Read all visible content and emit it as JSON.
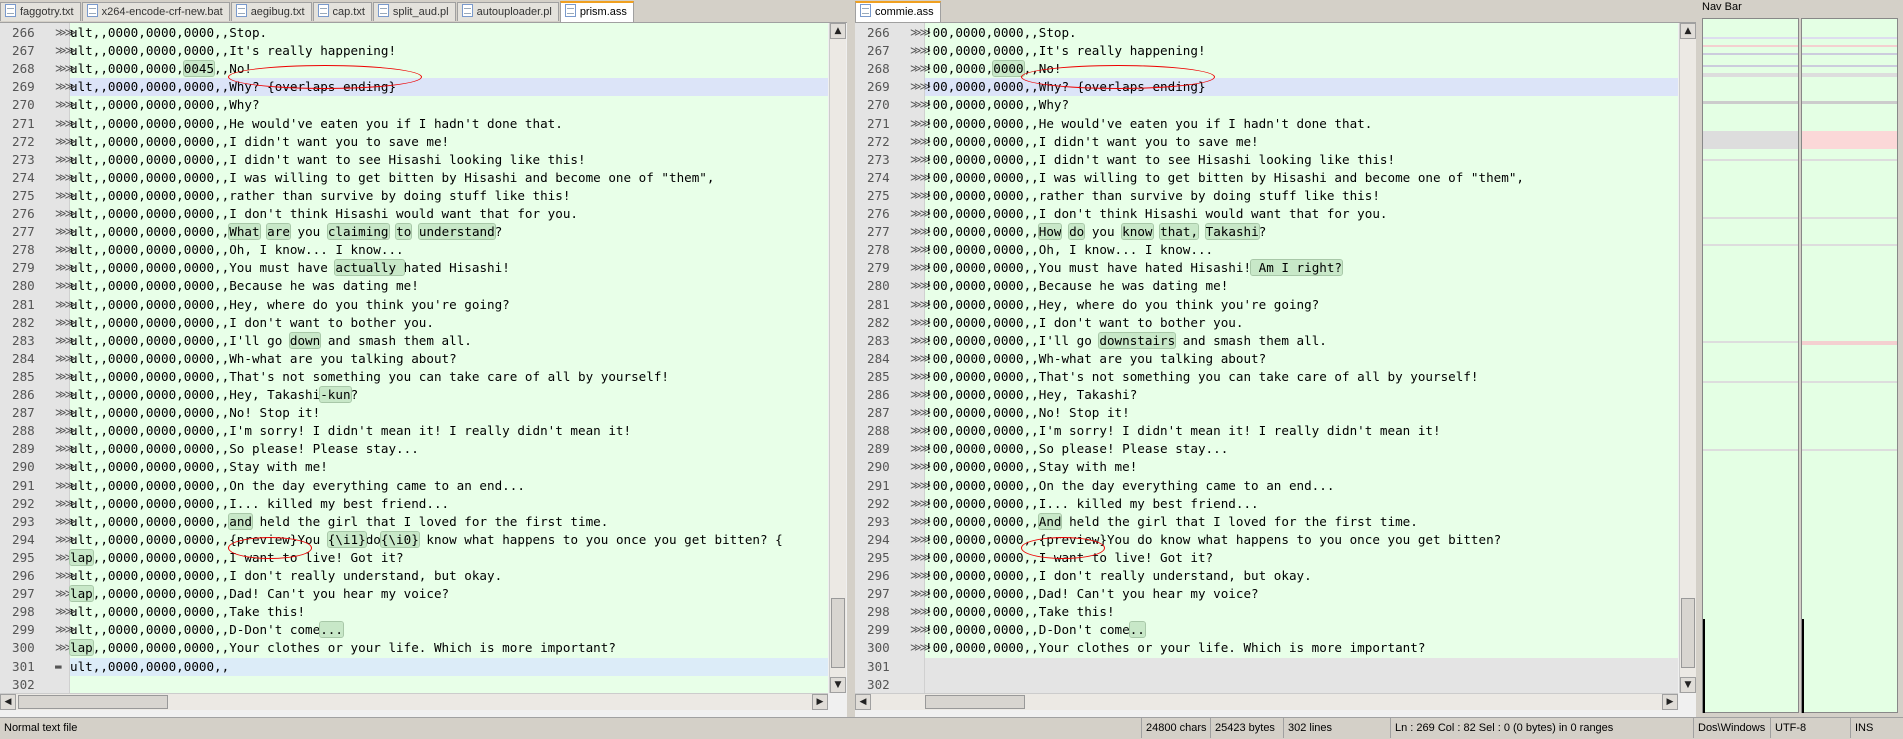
{
  "left_tabs": [
    {
      "label": "faggotry.txt",
      "active": false
    },
    {
      "label": "x264-encode-crf-new.bat",
      "active": false
    },
    {
      "label": "aegibug.txt",
      "active": false
    },
    {
      "label": "cap.txt",
      "active": false
    },
    {
      "label": "split_aud.pl",
      "active": false
    },
    {
      "label": "autouploader.pl",
      "active": false
    },
    {
      "label": "prism.ass",
      "active": true
    }
  ],
  "right_tabs": [
    {
      "label": "commie.ass",
      "active": true
    }
  ],
  "wrap_marker": "≫≫",
  "current_line_marker": "▬",
  "left_lines": [
    {
      "n": "266",
      "t": "ult,,0000,0000,0000,,Stop."
    },
    {
      "n": "267",
      "t": "ult,,0000,0000,0000,,It's really happening!"
    },
    {
      "n": "268",
      "t": "ult,,0000,0000,0045,,No!"
    },
    {
      "n": "269",
      "t": "ult,,0000,0000,0000,,Why? {overlaps ending}"
    },
    {
      "n": "270",
      "t": "ult,,0000,0000,0000,,Why?"
    },
    {
      "n": "271",
      "t": "ult,,0000,0000,0000,,He would've eaten you if I hadn't done that."
    },
    {
      "n": "272",
      "t": "ult,,0000,0000,0000,,I didn't want you to save me!"
    },
    {
      "n": "273",
      "t": "ult,,0000,0000,0000,,I didn't want to see Hisashi looking like this!"
    },
    {
      "n": "274",
      "t": "ult,,0000,0000,0000,,I was willing to get bitten by Hisashi and become one of \"them\","
    },
    {
      "n": "275",
      "t": "ult,,0000,0000,0000,,rather than survive by doing stuff like this!"
    },
    {
      "n": "276",
      "t": "ult,,0000,0000,0000,,I don't think Hisashi would want that for you."
    },
    {
      "n": "277",
      "t": "ult,,0000,0000,0000,,What are you claiming to understand?"
    },
    {
      "n": "278",
      "t": "ult,,0000,0000,0000,,Oh, I know... I know..."
    },
    {
      "n": "279",
      "t": "ult,,0000,0000,0000,,You must have actually hated Hisashi!"
    },
    {
      "n": "280",
      "t": "ult,,0000,0000,0000,,Because he was dating me!"
    },
    {
      "n": "281",
      "t": "ult,,0000,0000,0000,,Hey, where do you think you're going?"
    },
    {
      "n": "282",
      "t": "ult,,0000,0000,0000,,I don't want to bother you."
    },
    {
      "n": "283",
      "t": "ult,,0000,0000,0000,,I'll go down and smash them all."
    },
    {
      "n": "284",
      "t": "ult,,0000,0000,0000,,Wh-what are you talking about?"
    },
    {
      "n": "285",
      "t": "ult,,0000,0000,0000,,That's not something you can take care of all by yourself!"
    },
    {
      "n": "286",
      "t": "ult,,0000,0000,0000,,Hey, Takashi-kun?"
    },
    {
      "n": "287",
      "t": "ult,,0000,0000,0000,,No! Stop it!"
    },
    {
      "n": "288",
      "t": "ult,,0000,0000,0000,,I'm sorry! I didn't mean it! I really didn't mean it!"
    },
    {
      "n": "289",
      "t": "ult,,0000,0000,0000,,So please! Please stay..."
    },
    {
      "n": "290",
      "t": "ult,,0000,0000,0000,,Stay with me!"
    },
    {
      "n": "291",
      "t": "ult,,0000,0000,0000,,On the day everything came to an end..."
    },
    {
      "n": "292",
      "t": "ult,,0000,0000,0000,,I... killed my best friend..."
    },
    {
      "n": "293",
      "t": "ult,,0000,0000,0000,,and held the girl that I loved for the first time."
    },
    {
      "n": "294",
      "t": "ult,,0000,0000,0000,,{preview}You {\\i1}do{\\i0} know what happens to you once you get bitten? {"
    },
    {
      "n": "295",
      "t": "lap,,0000,0000,0000,,I want to live! Got it?"
    },
    {
      "n": "296",
      "t": "ult,,0000,0000,0000,,I don't really understand, but okay."
    },
    {
      "n": "297",
      "t": "lap,,0000,0000,0000,,Dad! Can't you hear my voice?"
    },
    {
      "n": "298",
      "t": "ult,,0000,0000,0000,,Take this!"
    },
    {
      "n": "299",
      "t": "ult,,0000,0000,0000,,D-Don't come..."
    },
    {
      "n": "300",
      "t": "lap,,0000,0000,0000,,Your clothes or your life. Which is more important?"
    },
    {
      "n": "301",
      "t": "ult,,0000,0000,0000,,"
    },
    {
      "n": "302",
      "t": ""
    }
  ],
  "right_lines": [
    {
      "n": "266",
      "t": "!00,0000,0000,,Stop."
    },
    {
      "n": "267",
      "t": "!00,0000,0000,,It's really happening!"
    },
    {
      "n": "268",
      "t": "!00,0000,0000,,No!"
    },
    {
      "n": "269",
      "t": "!00,0000,0000,,Why? {overlaps ending}"
    },
    {
      "n": "270",
      "t": "!00,0000,0000,,Why?"
    },
    {
      "n": "271",
      "t": "!00,0000,0000,,He would've eaten you if I hadn't done that."
    },
    {
      "n": "272",
      "t": "!00,0000,0000,,I didn't want you to save me!"
    },
    {
      "n": "273",
      "t": "!00,0000,0000,,I didn't want to see Hisashi looking like this!"
    },
    {
      "n": "274",
      "t": "!00,0000,0000,,I was willing to get bitten by Hisashi and become one of \"them\","
    },
    {
      "n": "275",
      "t": "!00,0000,0000,,rather than survive by doing stuff like this!"
    },
    {
      "n": "276",
      "t": "!00,0000,0000,,I don't think Hisashi would want that for you."
    },
    {
      "n": "277",
      "t": "!00,0000,0000,,How do you know that, Takashi?"
    },
    {
      "n": "278",
      "t": "!00,0000,0000,,Oh, I know... I know..."
    },
    {
      "n": "279",
      "t": "!00,0000,0000,,You must have hated Hisashi! Am I right?"
    },
    {
      "n": "280",
      "t": "!00,0000,0000,,Because he was dating me!"
    },
    {
      "n": "281",
      "t": "!00,0000,0000,,Hey, where do you think you're going?"
    },
    {
      "n": "282",
      "t": "!00,0000,0000,,I don't want to bother you."
    },
    {
      "n": "283",
      "t": "!00,0000,0000,,I'll go downstairs and smash them all."
    },
    {
      "n": "284",
      "t": "!00,0000,0000,,Wh-what are you talking about?"
    },
    {
      "n": "285",
      "t": "!00,0000,0000,,That's not something you can take care of all by yourself!"
    },
    {
      "n": "286",
      "t": "!00,0000,0000,,Hey, Takashi?"
    },
    {
      "n": "287",
      "t": "!00,0000,0000,,No! Stop it!"
    },
    {
      "n": "288",
      "t": "!00,0000,0000,,I'm sorry! I didn't mean it! I really didn't mean it!"
    },
    {
      "n": "289",
      "t": "!00,0000,0000,,So please! Please stay..."
    },
    {
      "n": "290",
      "t": "!00,0000,0000,,Stay with me!"
    },
    {
      "n": "291",
      "t": "!00,0000,0000,,On the day everything came to an end..."
    },
    {
      "n": "292",
      "t": "!00,0000,0000,,I... killed my best friend..."
    },
    {
      "n": "293",
      "t": "!00,0000,0000,,And held the girl that I loved for the first time."
    },
    {
      "n": "294",
      "t": "!00,0000,0000,,{preview}You do know what happens to you once you get bitten?"
    },
    {
      "n": "295",
      "t": "!00,0000,0000,,I want to live! Got it?"
    },
    {
      "n": "296",
      "t": "!00,0000,0000,,I don't really understand, but okay."
    },
    {
      "n": "297",
      "t": "!00,0000,0000,,Dad! Can't you hear my voice?"
    },
    {
      "n": "298",
      "t": "!00,0000,0000,,Take this!"
    },
    {
      "n": "299",
      "t": "!00,0000,0000,,D-Don't come.."
    },
    {
      "n": "300",
      "t": "!00,0000,0000,,Your clothes or your life. Which is more important?"
    },
    {
      "n": "301",
      "t": ""
    },
    {
      "n": "302",
      "t": ""
    }
  ],
  "nav_bar": {
    "title": "Nav Bar"
  },
  "status": {
    "file_type": "Normal text file",
    "chars": "24800 chars",
    "bytes": "25423 bytes",
    "lines": "302 lines",
    "position": "Ln : 269    Col : 82    Sel : 0 (0 bytes) in 0 ranges",
    "eol": "Dos\\Windows",
    "encoding": "UTF-8",
    "mode": "INS"
  },
  "colors": {
    "editor_bg": "#e8ffe8",
    "diff_highlight": "#c8e8c8",
    "current_line": "#dce4f8",
    "annotation": "#e00000",
    "active_tab_accent": "#f0a020"
  }
}
